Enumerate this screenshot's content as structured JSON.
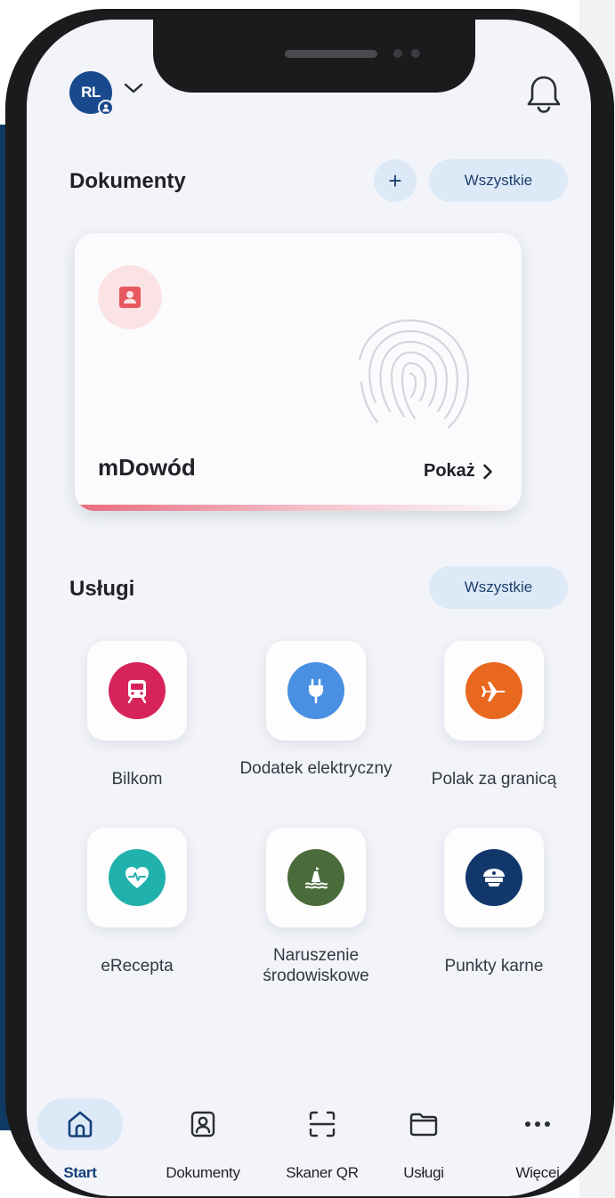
{
  "header": {
    "avatar_initials": "RL",
    "avatar_icon": "user-badge-icon",
    "account_switch_icon": "chevron-down-icon",
    "notifications_icon": "bell-icon"
  },
  "documents": {
    "title": "Dokumenty",
    "add_label": "+",
    "all_label": "Wszystkie",
    "card": {
      "name": "mDowód",
      "show_label": "Pokaż",
      "icon": "id-card-icon",
      "accent_color": "#e86a7c"
    }
  },
  "services": {
    "title": "Usługi",
    "all_label": "Wszystkie",
    "items": [
      {
        "label": "Bilkom",
        "icon": "train-icon",
        "color": "#d6245a"
      },
      {
        "label": "Dodatek elektryczny",
        "icon": "plug-icon",
        "color": "#4a90e2"
      },
      {
        "label": "Polak za granicą",
        "icon": "plane-icon",
        "color": "#e8681f"
      },
      {
        "label": "eRecepta",
        "icon": "heart-pulse-icon",
        "color": "#21b1ad"
      },
      {
        "label": "Naruszenie środowiskowe",
        "icon": "buoy-water-icon",
        "color": "#4a6b3a"
      },
      {
        "label": "Punkty karne",
        "icon": "police-cap-icon",
        "color": "#12386b"
      }
    ]
  },
  "nav": {
    "items": [
      {
        "label": "Start",
        "icon": "home-icon",
        "active": true
      },
      {
        "label": "Dokumenty",
        "icon": "document-person-icon",
        "active": false
      },
      {
        "label": "Skaner QR",
        "icon": "qr-scanner-icon",
        "active": false
      },
      {
        "label": "Usługi",
        "icon": "folder-icon",
        "active": false
      },
      {
        "label": "Więcej",
        "icon": "more-dots-icon",
        "active": false
      }
    ]
  }
}
